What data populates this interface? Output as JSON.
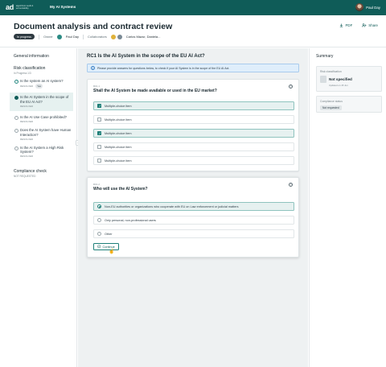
{
  "topbar": {
    "logo_mark": "ad",
    "logo_text": "algorithmic audit & accountability",
    "nav_label": "My AI Systems",
    "user_name": "Paul Day"
  },
  "header": {
    "title": "Document analysis and contract review",
    "status": "In progress",
    "owner_label": "Owner",
    "owner_name": "Paul Day",
    "collaborators_label": "Collaborators",
    "collaborators_names": "Carlos Mazur, Daniela...",
    "pdf_label": "PDF",
    "share_label": "Share"
  },
  "sidebar": {
    "general": "General information",
    "risk_title": "Risk classification",
    "risk_sub": "In Progress 1/3",
    "items": [
      {
        "label": "Is the system an AI system?",
        "meta": "RESOLVED",
        "tag": "Yes"
      },
      {
        "label": "Is the AI System in the scope of the EU AI Act?",
        "meta": "RESOLVED"
      },
      {
        "label": "Is the AI Use Case prohibited?",
        "meta": "RESOLVED"
      },
      {
        "label": "Does the AI System have Human Interaction?",
        "meta": "RESOLVED"
      },
      {
        "label": "Is the AI System a High Risk System?",
        "meta": "RESOLVED"
      }
    ],
    "compliance_title": "Compliance check",
    "compliance_sub": "NOT REQUESTED"
  },
  "main": {
    "section_title": "RC1 Is the AI System in the scope of the EU AI Act?",
    "info_text": "Please provide answers for questions below, to check if your AI System is in the scope of the EU AI Act.",
    "q1": {
      "number": "RC1.1",
      "text": "Shall the AI System be made available or used in the EU market?",
      "options": [
        {
          "label": "Multiple-choice item",
          "checked": true
        },
        {
          "label": "Multiple-choice item",
          "checked": false
        },
        {
          "label": "Multiple-choice item",
          "checked": true
        },
        {
          "label": "Multiple-choice item",
          "checked": false
        },
        {
          "label": "Multiple-choice item",
          "checked": false
        }
      ]
    },
    "q2": {
      "number": "RC1.2",
      "text": "Who will use the AI System?",
      "options": [
        {
          "label": "Non-EU authorities or organizations who cooperate with EU on Law enforcement or judicial matters",
          "selected": true
        },
        {
          "label": "Only personal, non-professional users",
          "selected": false
        },
        {
          "label": "Other",
          "selected": false
        }
      ],
      "continue_label": "Continue"
    }
  },
  "summary": {
    "title": "Summary",
    "risk_label": "Risk classification",
    "risk_value": "Not specified",
    "risk_note": "Updated on 15 Jun",
    "compliance_label": "Compliance status",
    "compliance_value": "Not requested"
  }
}
